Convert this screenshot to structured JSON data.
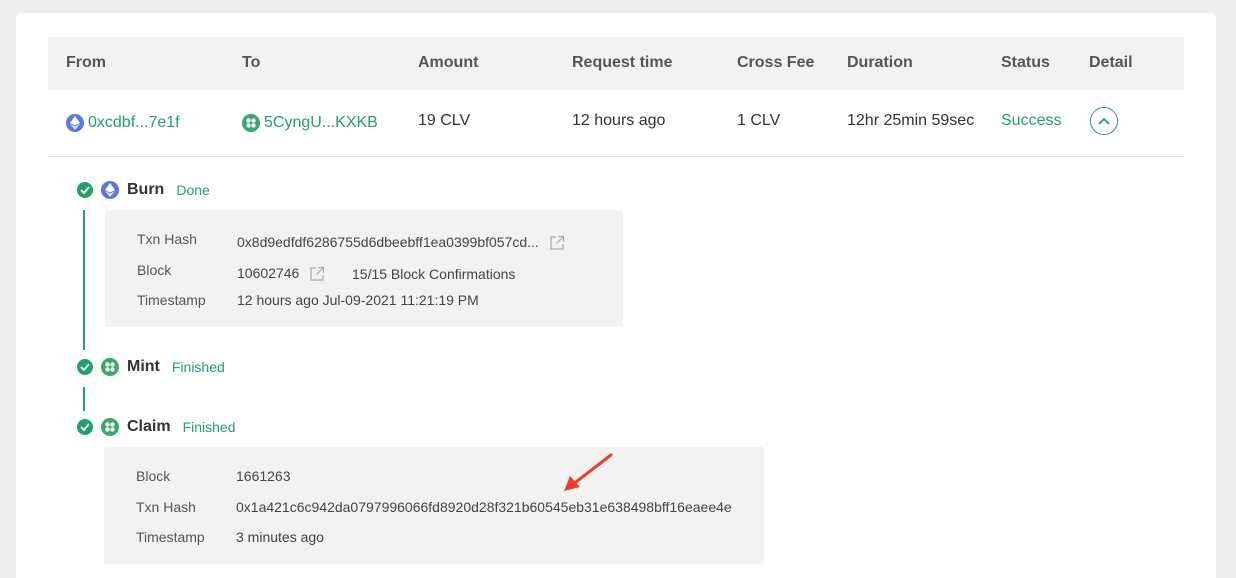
{
  "table": {
    "headers": [
      "From",
      "To",
      "Amount",
      "Request time",
      "Cross Fee",
      "Duration",
      "Status",
      "Detail"
    ],
    "row": {
      "from": "0xcdbf...7e1f",
      "to": "5CyngU...KXKB",
      "amount": "19 CLV",
      "request_time": "12 hours ago",
      "cross_fee": "1 CLV",
      "duration": "12hr 25min 59sec",
      "status": "Success"
    }
  },
  "steps": {
    "burn": {
      "title": "Burn",
      "status": "Done",
      "txn_hash_label": "Txn Hash",
      "txn_hash": "0x8d9edfdf6286755d6dbeebff1ea0399bf057cd...",
      "block_label": "Block",
      "block": "10602746",
      "confirmations": "15/15 Block Confirmations",
      "timestamp_label": "Timestamp",
      "timestamp": "12 hours ago Jul-09-2021 11:21:19 PM"
    },
    "mint": {
      "title": "Mint",
      "status": "Finished"
    },
    "claim": {
      "title": "Claim",
      "status": "Finished",
      "block_label": "Block",
      "block": "1661263",
      "txn_hash_label": "Txn Hash",
      "txn_hash": "0x1a421c6c942da0797996066fd8920d28f321b60545eb31e638498bff16eaee4e",
      "timestamp_label": "Timestamp",
      "timestamp": "3 minutes ago"
    }
  },
  "icons": {
    "ethereum": "ethereum-icon",
    "polkadot": "polkadot-icon",
    "check": "check-circle-icon",
    "expand": "chevron-up-icon",
    "external": "external-link-icon",
    "annotation": "red-arrow-icon"
  },
  "colors": {
    "accent": "#22a06b",
    "ethereum": "#5b78e0",
    "annotation": "#e8412c"
  }
}
